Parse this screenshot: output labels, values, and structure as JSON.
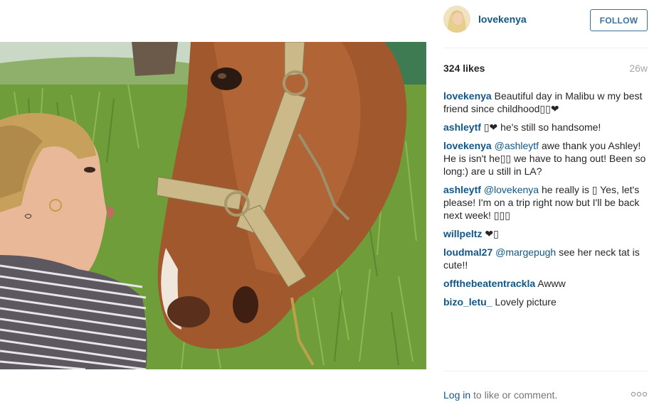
{
  "post": {
    "author": "lovekenya",
    "follow_label": "FOLLOW",
    "likes": "324 likes",
    "age": "26w"
  },
  "comments": [
    {
      "user": "lovekenya",
      "mention": "",
      "text": "Beautiful day in Malibu w my best friend since childhood▯▯❤"
    },
    {
      "user": "ashleytf",
      "mention": "",
      "text": "▯❤ he's still so handsome!"
    },
    {
      "user": "lovekenya",
      "mention": "@ashleytf",
      "text": "awe thank you Ashley! He is isn't he▯▯ we have to hang out! Been so long:) are u still in LA?"
    },
    {
      "user": "ashleytf",
      "mention": "@lovekenya",
      "text": "he really is ▯ Yes, let's please! I'm on a trip right now but I'll be back next week! ▯▯▯"
    },
    {
      "user": "willpeltz",
      "mention": "",
      "text": "❤▯"
    },
    {
      "user": "loudmal27",
      "mention": "@margepugh",
      "text": "see her neck tat is cute!!"
    },
    {
      "user": "offthebeatentrackla",
      "mention": "",
      "text": "Awww"
    },
    {
      "user": "bizo_letu_",
      "mention": "",
      "text": "Lovely picture"
    }
  ],
  "footer": {
    "login_link": "Log in",
    "login_suffix": "to like or comment."
  },
  "icons": {
    "more": "more-options-icon",
    "avatar": "profile-avatar"
  },
  "colors": {
    "link": "#125688",
    "follow_border": "#3f729b",
    "muted": "#a5a7aa"
  }
}
